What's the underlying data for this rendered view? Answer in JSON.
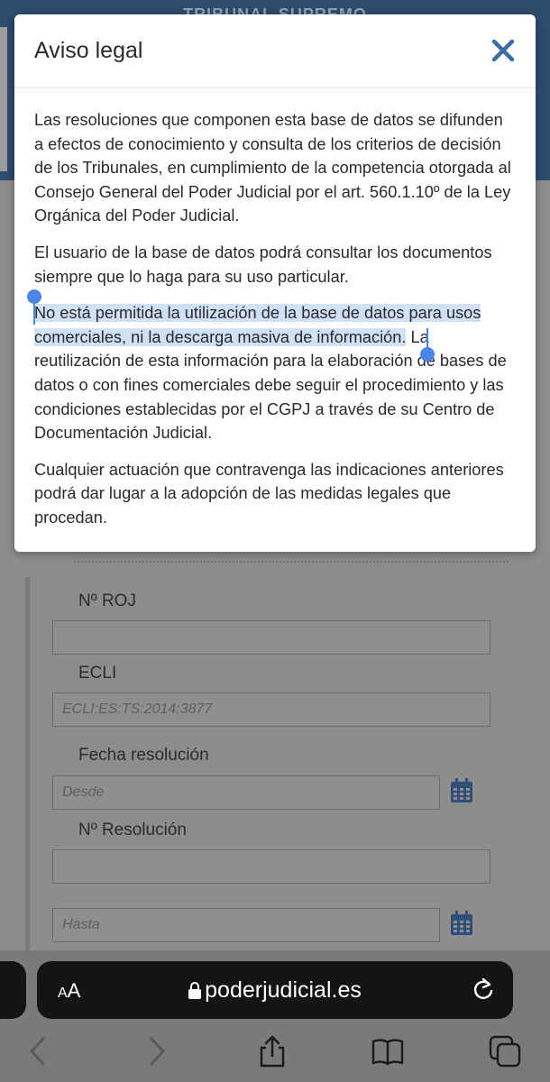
{
  "background": {
    "header_title": "TRIBUNAL SUPREMO",
    "fields": [
      {
        "label": "Nº ROJ",
        "value": "",
        "placeholder": ""
      },
      {
        "label": "ECLI",
        "value": "",
        "placeholder": "ECLI:ES:TS:2014:3877"
      },
      {
        "label": "Fecha resolución",
        "value": "",
        "placeholder": "Desde"
      },
      {
        "label": "Nº Resolución",
        "value": "",
        "placeholder": ""
      },
      {
        "label": "",
        "value": "",
        "placeholder": "Hasta"
      }
    ]
  },
  "modal": {
    "title": "Aviso legal",
    "close_icon": "close-icon",
    "paragraphs": [
      "Las resoluciones que componen esta base de datos se difunden a efectos de conocimiento y consulta de los criterios de decisión de los Tribunales, en cumplimiento de la competencia otorgada al Consejo General del Poder Judicial por el art. 560.1.10º de la Ley Orgánica del Poder Judicial.",
      "El usuario de la base de datos podrá consultar los documentos siempre que lo haga para su uso particular.",
      "Cualquier actuación que contravenga las indicaciones anteriores podrá dar lugar a la adopción de las medidas legales que procedan."
    ],
    "selected_paragraph": {
      "selected_text": "No está permitida la utilización de la base de datos para usos comerciales, ni la descarga masiva de información.",
      "rest_text": " La reutilización de esta información para la elaboración de bases de datos o con fines comerciales debe seguir el procedimiento y las condiciones establecidas por el CGPJ a través de su Centro de Documentación Judicial."
    }
  },
  "browser": {
    "text_size_big": "A",
    "text_size_small": "A",
    "url": "poderjudicial.es",
    "colors": {
      "selection": "#cfe0f7",
      "handle": "#4a86e8",
      "close": "#3b6ea8"
    }
  }
}
